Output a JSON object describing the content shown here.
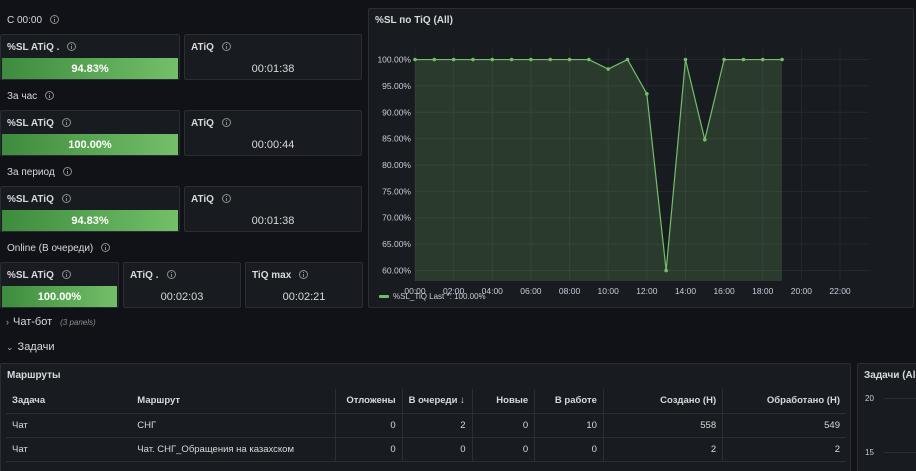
{
  "rows": [
    {
      "title": "С 00:00",
      "sl_label": "%SL ATiQ .",
      "sl_value": "94.83%",
      "atiq_label": "ATiQ",
      "atiq_value": "00:01:38"
    },
    {
      "title": "За час",
      "sl_label": "%SL ATiQ",
      "sl_value": "100.00%",
      "atiq_label": "ATiQ",
      "atiq_value": "00:00:44"
    },
    {
      "title": "За период",
      "sl_label": "%SL ATiQ",
      "sl_value": "94.83%",
      "atiq_label": "ATiQ",
      "atiq_value": "00:01:38"
    }
  ],
  "online": {
    "title": "Online (В очереди)",
    "sl_label": "%SL ATiQ",
    "sl_value": "100.00%",
    "atiq_label": "ATiQ .",
    "atiq_value": "00:02:03",
    "tiqmax_label": "TiQ max",
    "tiqmax_value": "00:02:21"
  },
  "chart_panel": {
    "title": "%SL по TiQ (All)"
  },
  "chart_data": {
    "type": "area",
    "title": "%SL по TiQ (All)",
    "x": [
      "00:00",
      "01:00",
      "02:00",
      "03:00",
      "04:00",
      "05:00",
      "06:00",
      "07:00",
      "08:00",
      "09:00",
      "10:00",
      "11:00",
      "12:00",
      "13:00",
      "14:00",
      "15:00",
      "16:00",
      "17:00",
      "18:00",
      "19:00"
    ],
    "x_hours": [
      0,
      1,
      2,
      3,
      4,
      5,
      6,
      7,
      8,
      9,
      10,
      11,
      12,
      13,
      14,
      15,
      16,
      17,
      18,
      19
    ],
    "series": [
      {
        "name": "%SL_TiQ",
        "values": [
          100,
          100,
          100,
          100,
          100,
          100,
          100,
          100,
          100,
          100,
          98.2,
          100,
          93.5,
          60,
          100,
          84.8,
          100,
          100,
          100,
          100
        ],
        "color": "#73bf69"
      }
    ],
    "xticks": [
      "00:00",
      "02:00",
      "04:00",
      "06:00",
      "08:00",
      "10:00",
      "12:00",
      "14:00",
      "16:00",
      "18:00",
      "20:00",
      "22:00"
    ],
    "yticks": [
      "60.00%",
      "65.00%",
      "70.00%",
      "75.00%",
      "80.00%",
      "85.00%",
      "90.00%",
      "95.00%",
      "100.00%"
    ],
    "ylim": [
      58,
      102
    ],
    "xlim_hours": [
      0,
      23.5
    ],
    "legend_text": "%SL_TiQ  Last *: 100.00%",
    "legend_placement": "bottom-left",
    "grid": true
  },
  "chatbot": {
    "label": "Чат-бот",
    "note": "(3 panels)"
  },
  "tasks": {
    "label": "Задачи"
  },
  "routes_panel": {
    "title": "Маршруты",
    "columns": [
      "Задача",
      "Маршрут",
      "Отложены",
      "В очереди ↓",
      "Новые",
      "В работе",
      "Создано (Н)",
      "Обработано (Н)"
    ],
    "rows": [
      [
        "Чат",
        "СНГ",
        "0",
        "2",
        "0",
        "10",
        "558",
        "549"
      ],
      [
        "Чат",
        "Чат. СНГ_Обращения на казахском",
        "0",
        "0",
        "0",
        "0",
        "2",
        "2"
      ]
    ]
  },
  "tasks_chart_panel": {
    "title": "Задачи (All",
    "yticks": [
      "20",
      "15"
    ]
  },
  "colors": {
    "accent_green": "#73bf69",
    "panel_bg": "#181b1f",
    "page_bg": "#111217"
  }
}
